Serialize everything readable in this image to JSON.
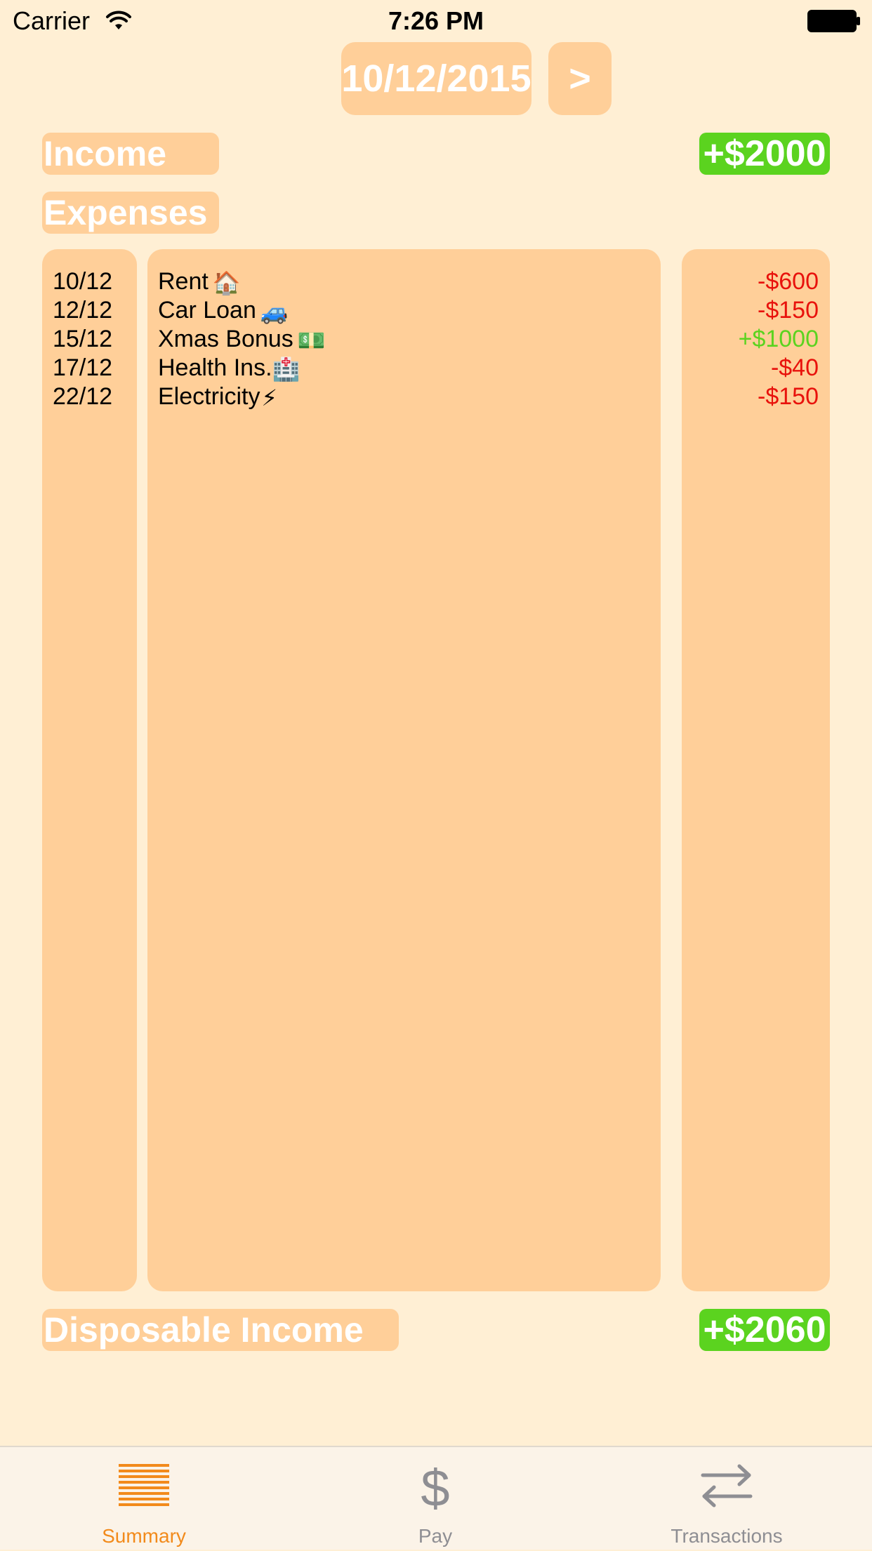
{
  "status_bar": {
    "carrier": "Carrier",
    "time": "7:26 PM"
  },
  "header": {
    "date": "10/12/2015",
    "next_label": ">"
  },
  "income": {
    "label": "Income",
    "amount": "+$2000"
  },
  "expenses": {
    "label": "Expenses",
    "rows": [
      {
        "date": "10/12",
        "description": "Rent",
        "emoji": "🏠",
        "amount": "-$600",
        "sign": "negative"
      },
      {
        "date": "12/12",
        "description": "Car Loan",
        "emoji": "🚙",
        "amount": "-$150",
        "sign": "negative"
      },
      {
        "date": "15/12",
        "description": "Xmas Bonus",
        "emoji": "💵",
        "amount": "+$1000",
        "sign": "positive"
      },
      {
        "date": "17/12",
        "description": "Health Ins.",
        "emoji": "🏥",
        "amount": "-$40",
        "sign": "negative"
      },
      {
        "date": "22/12",
        "description": "Electricity",
        "emoji": "⚡",
        "amount": "-$150",
        "sign": "negative"
      }
    ]
  },
  "disposable": {
    "label": "Disposable Income",
    "amount": "+$2060"
  },
  "tab_bar": {
    "tabs": [
      {
        "label": "Summary",
        "icon": "summary-lines-icon",
        "selected": true
      },
      {
        "label": "Pay",
        "icon": "dollar-icon",
        "selected": false
      },
      {
        "label": "Transactions",
        "icon": "transfer-arrows-icon",
        "selected": false
      }
    ]
  },
  "colors": {
    "background": "#FFEFD4",
    "panel": "#FFCF99",
    "green": "#5BD31F",
    "negative": "#E8120C",
    "tab_active": "#F28A1B",
    "tab_inactive": "#8E8E93"
  }
}
